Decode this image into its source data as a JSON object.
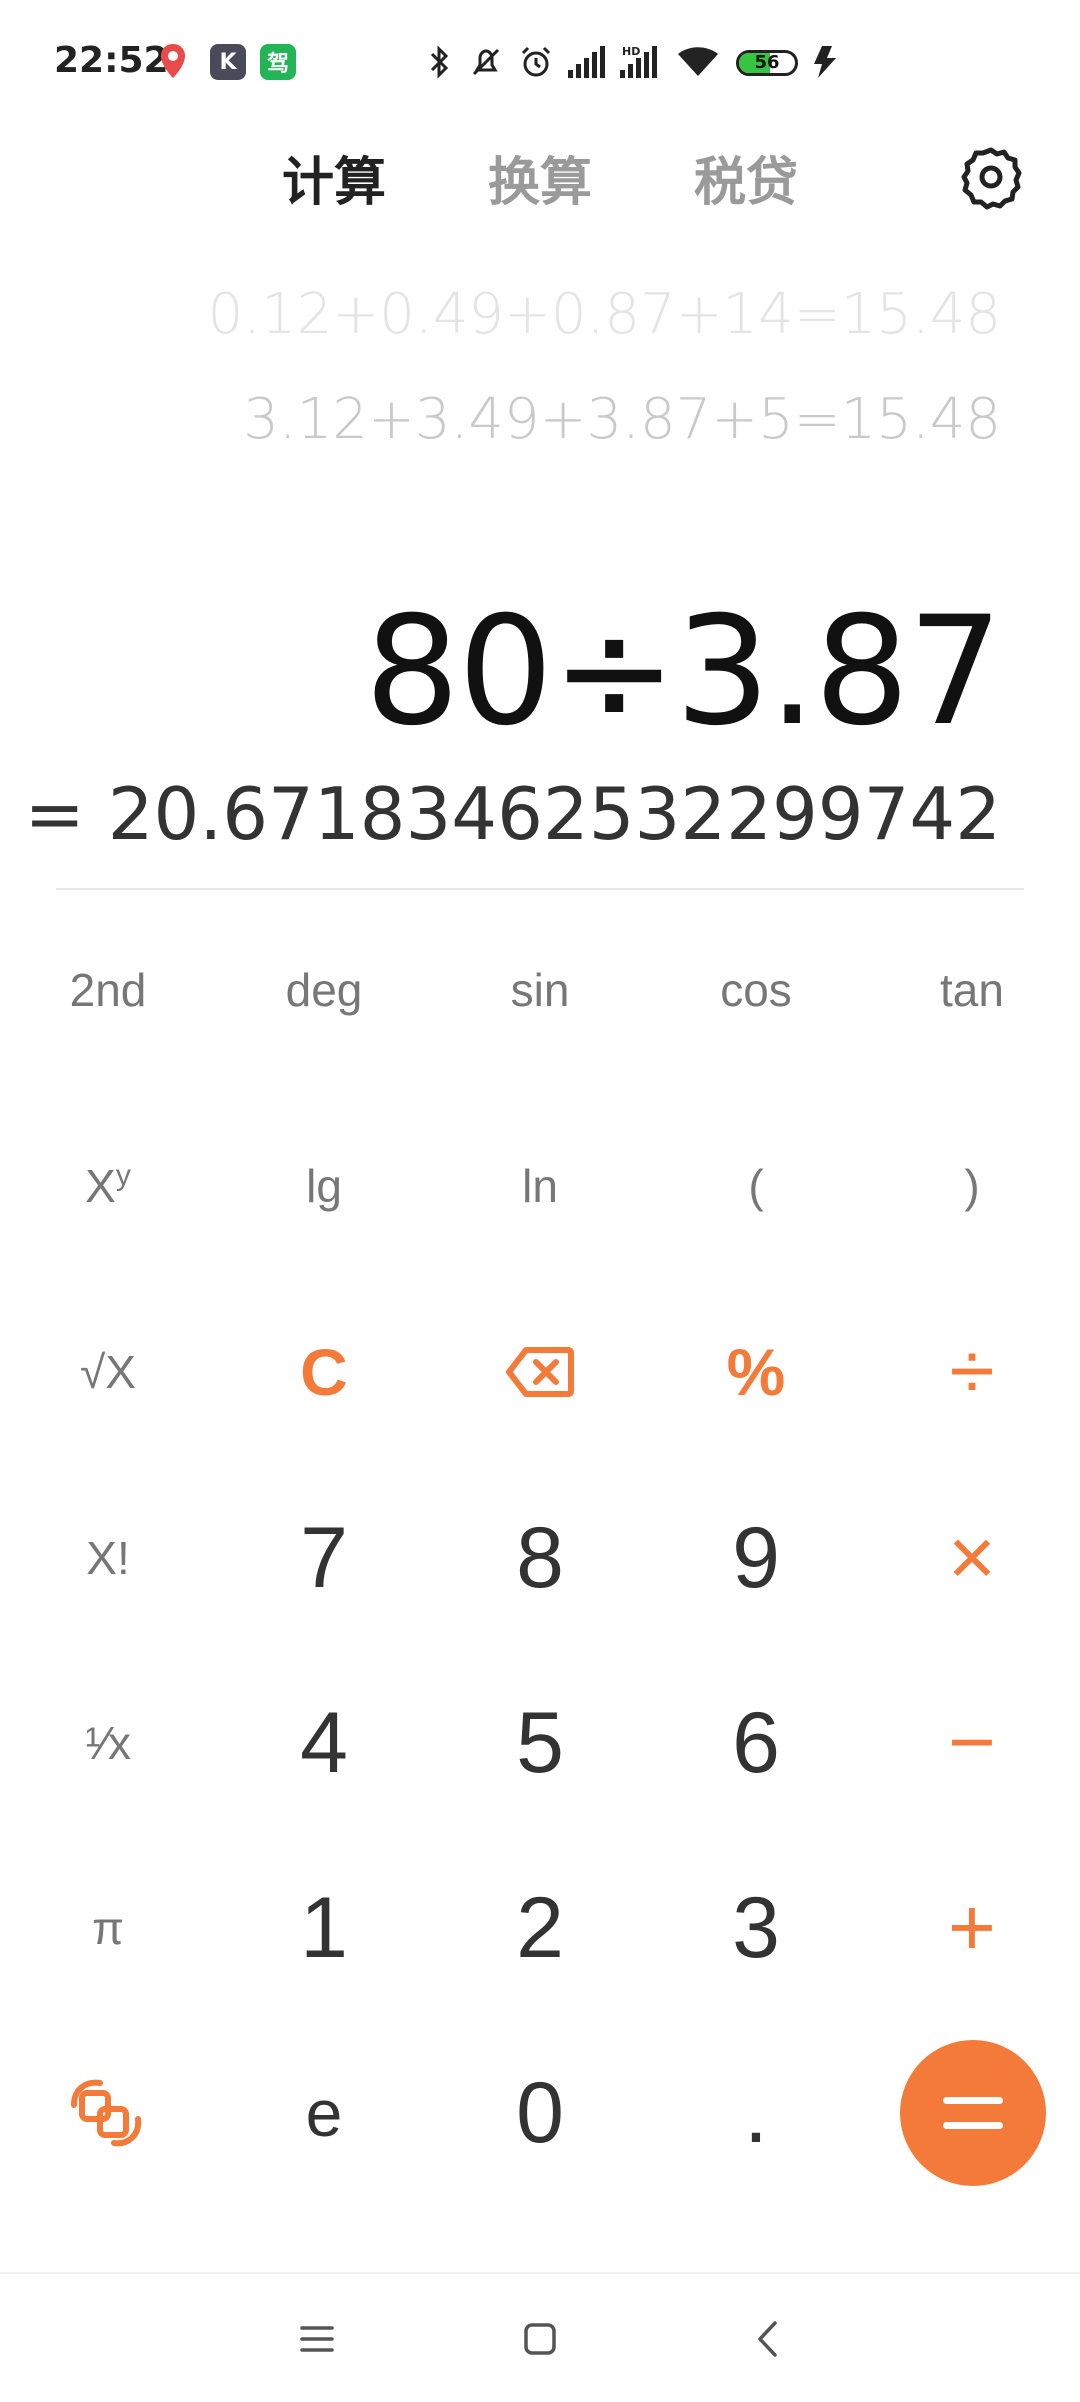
{
  "status_bar": {
    "time": "22:52",
    "battery_level": "56",
    "battery_fraction": 0.56,
    "badge_k": "K",
    "badge_jia": "驾",
    "icons": [
      "location-app-icon",
      "k-app-icon",
      "jia-app-icon",
      "bluetooth-icon",
      "mute-icon",
      "alarm-icon",
      "signal-icon",
      "signal-hd-icon",
      "wifi-icon",
      "battery-icon",
      "charging-icon"
    ]
  },
  "tabs": [
    {
      "label": "计算",
      "active": true
    },
    {
      "label": "换算",
      "active": false
    },
    {
      "label": "税贷",
      "active": false
    }
  ],
  "history": [
    "0.12+0.49+0.87+14=15.48",
    "3.12+3.49+3.87+5=15.48"
  ],
  "display": {
    "expression": "80÷3.87",
    "result": "= 20.67183462532299742"
  },
  "keys": {
    "row1": [
      "2nd",
      "deg",
      "sin",
      "cos",
      "tan"
    ],
    "row2": [
      "lg",
      "ln",
      "(",
      ")"
    ],
    "power_base": "X",
    "power_exp": "y",
    "sqrt": "√X",
    "clear": "C",
    "percent": "%",
    "divide": "÷",
    "factorial": "X!",
    "reciprocal": "¹⁄x",
    "pi": "π",
    "e": "e",
    "dot": ".",
    "multiply": "×",
    "minus": "−",
    "plus": "+",
    "digits": {
      "d0": "0",
      "d1": "1",
      "d2": "2",
      "d3": "3",
      "d4": "4",
      "d5": "5",
      "d6": "6",
      "d7": "7",
      "d8": "8",
      "d9": "9"
    }
  },
  "colors": {
    "accent": "#f47a3a",
    "primary_text": "#111111",
    "secondary_text": "#777777",
    "history_text": "#c9c9c9"
  }
}
